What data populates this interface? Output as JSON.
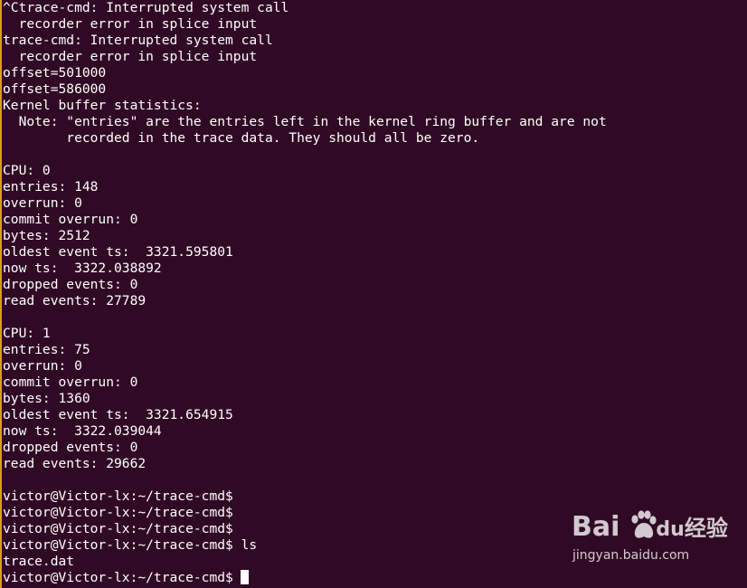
{
  "terminal": {
    "background": "#300a24",
    "foreground": "#ffffff",
    "lines": [
      "^Ctrace-cmd: Interrupted system call",
      "  recorder error in splice input",
      "trace-cmd: Interrupted system call",
      "  recorder error in splice input",
      "offset=501000",
      "offset=586000",
      "Kernel buffer statistics:",
      "  Note: \"entries\" are the entries left in the kernel ring buffer and are not",
      "        recorded in the trace data. They should all be zero.",
      "",
      "CPU: 0",
      "entries: 148",
      "overrun: 0",
      "commit overrun: 0",
      "bytes: 2512",
      "oldest event ts:  3321.595801",
      "now ts:  3322.038892",
      "dropped events: 0",
      "read events: 27789",
      "",
      "CPU: 1",
      "entries: 75",
      "overrun: 0",
      "commit overrun: 0",
      "bytes: 1360",
      "oldest event ts:  3321.654915",
      "now ts:  3322.039044",
      "dropped events: 0",
      "read events: 29662",
      "",
      "victor@Victor-lx:~/trace-cmd$",
      "victor@Victor-lx:~/trace-cmd$",
      "victor@Victor-lx:~/trace-cmd$",
      "victor@Victor-lx:~/trace-cmd$ ls",
      "trace.dat"
    ],
    "prompt_line": "victor@Victor-lx:~/trace-cmd$",
    "cursor_icon": "block-cursor"
  },
  "watermark": {
    "brand_left": "Bai",
    "brand_right": "经验",
    "brand_mid": "du",
    "subtitle": "jingyan.baidu.com",
    "icon": "baidu-paw-icon"
  }
}
